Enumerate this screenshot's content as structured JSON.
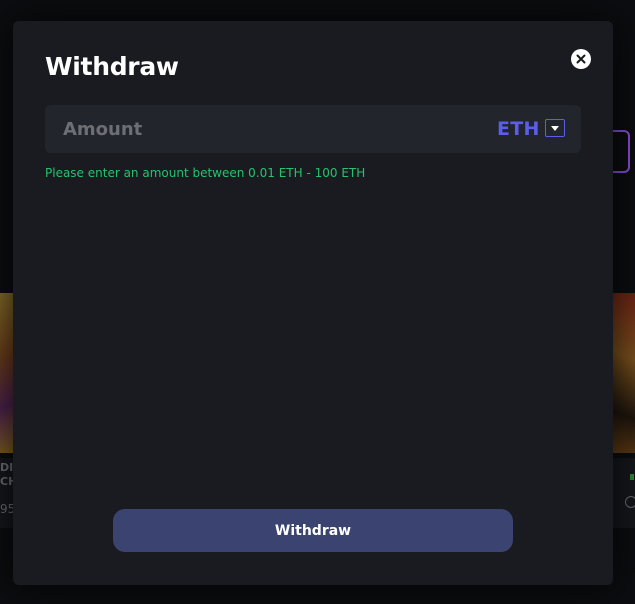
{
  "modal": {
    "title": "Withdraw",
    "amount_field": {
      "placeholder": "Amount",
      "value": "",
      "currency": "ETH"
    },
    "hint": "Please enter an amount between 0.01 ETH - 100 ETH",
    "submit_label": "Withdraw"
  },
  "background": {
    "left_card_lines": [
      "DIN",
      "CH",
      "95"
    ]
  },
  "colors": {
    "accent": "#5b5ee6",
    "hint": "#27c26a",
    "button": "#3b4470",
    "modal_bg": "#1a1b20",
    "field_bg": "#23252d"
  },
  "icons": {
    "close": "close-icon",
    "dropdown": "chevron-down-icon"
  }
}
